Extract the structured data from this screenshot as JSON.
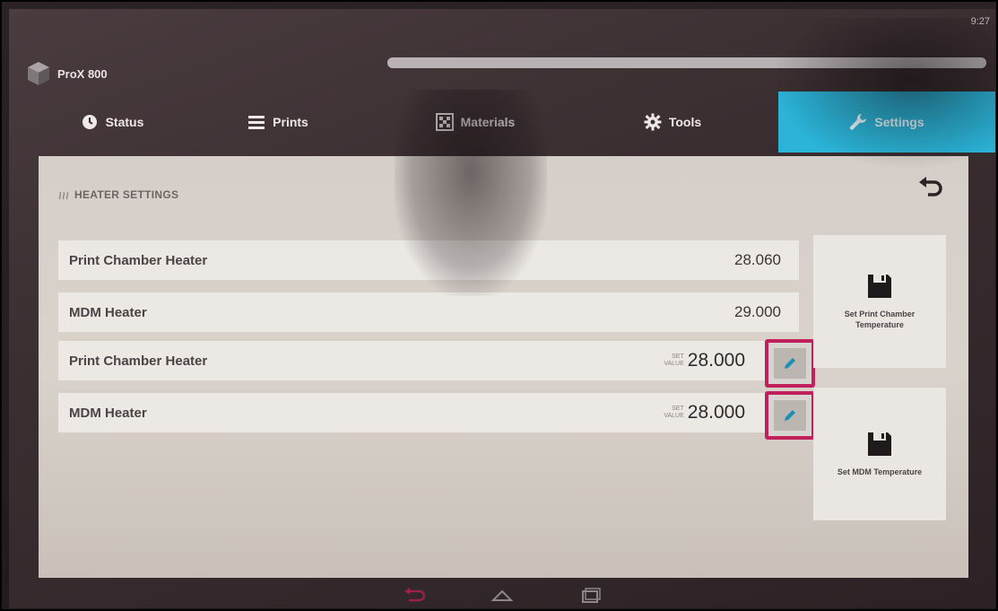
{
  "status_bar": {
    "time": "9:27"
  },
  "app": {
    "title": "ProX 800",
    "progress": 1.0
  },
  "tabs": [
    {
      "label": "Status",
      "icon": "clock-icon",
      "active": false
    },
    {
      "label": "Prints",
      "icon": "list-icon",
      "active": false
    },
    {
      "label": "Materials",
      "icon": "materials-icon",
      "active": false
    },
    {
      "label": "Tools",
      "icon": "gear-icon",
      "active": false
    },
    {
      "label": "Settings",
      "icon": "wrench-icon",
      "active": true
    }
  ],
  "panel": {
    "title": "HEATER SETTINGS",
    "readings": [
      {
        "label": "Print Chamber Heater",
        "value": "28.060"
      },
      {
        "label": "MDM Heater",
        "value": "29.000"
      }
    ],
    "setpoints": [
      {
        "label": "Print Chamber Heater",
        "caption_top": "SET",
        "caption_bottom": "VALUE",
        "value": "28.000"
      },
      {
        "label": "MDM Heater",
        "caption_top": "SET",
        "caption_bottom": "VALUE",
        "value": "28.000"
      }
    ],
    "actions": [
      {
        "label": "Set Print Chamber Temperature",
        "icon": "save-icon"
      },
      {
        "label": "Set MDM Temperature",
        "icon": "save-icon"
      }
    ]
  },
  "colors": {
    "accent": "#2bb4d8",
    "highlight": "#c0215c",
    "panel": "#d6cfc9"
  }
}
